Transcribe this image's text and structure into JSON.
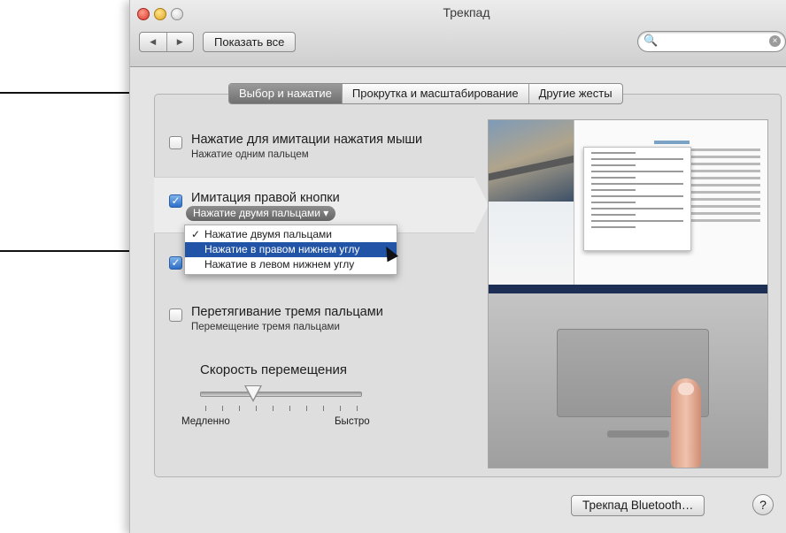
{
  "window": {
    "title": "Трекпад",
    "nav_back": "◀",
    "nav_forward": "▶",
    "show_all": "Показать все",
    "search_placeholder": ""
  },
  "tabs": [
    {
      "label": "Выбор и нажатие",
      "active": true
    },
    {
      "label": "Прокрутка и масштабирование",
      "active": false
    },
    {
      "label": "Другие жесты",
      "active": false
    }
  ],
  "options": [
    {
      "title": "Нажатие для имитации нажатия мыши",
      "subtitle": "Нажатие одним пальцем",
      "checked": false
    },
    {
      "title": "Имитация правой кнопки",
      "subtitle": "Нажатие двумя пальцами",
      "checked": true
    },
    {
      "title": "",
      "subtitle": "",
      "checked": true
    },
    {
      "title": "Перетягивание тремя пальцами",
      "subtitle": "Перемещение тремя пальцами",
      "checked": false
    }
  ],
  "dropdown": {
    "current": "Нажатие двумя пальцами ▾",
    "items": [
      {
        "label": "Нажатие двумя пальцами",
        "checked": true,
        "highlighted": false
      },
      {
        "label": "Нажатие в правом нижнем углу",
        "checked": false,
        "highlighted": true
      },
      {
        "label": "Нажатие в левом нижнем углу",
        "checked": false,
        "highlighted": false
      }
    ],
    "check_glyph": "✓"
  },
  "speed": {
    "label": "Скорость перемещения",
    "min_label": "Медленно",
    "max_label": "Быстро",
    "value_fraction": 0.33
  },
  "footer": {
    "bluetooth_button": "Трекпад Bluetooth…",
    "help_button": "?"
  },
  "icons": {
    "search": "🔍",
    "clear": "×",
    "checkbox_check": "✓"
  },
  "colors": {
    "selection": "#2153a6",
    "checkbox_checked": "#2f6fc8",
    "active_tab": "#7a7a7a"
  }
}
